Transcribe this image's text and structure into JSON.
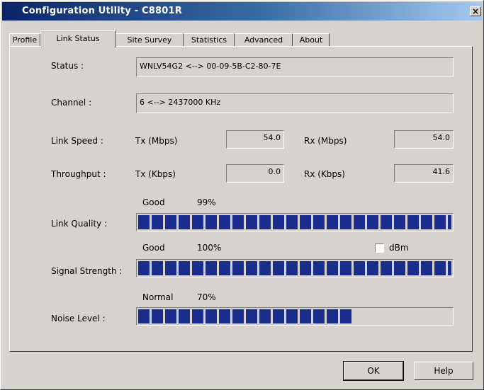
{
  "window": {
    "title": "Configuration Utility - C8801R",
    "close": "×"
  },
  "tabs": [
    "Profile",
    "Link Status",
    "Site Survey",
    "Statistics",
    "Advanced",
    "About"
  ],
  "active_tab": "Link Status",
  "status": {
    "label": "Status :",
    "value": "WNLV54G2 <--> 00-09-5B-C2-80-7E"
  },
  "channel": {
    "label": "Channel :",
    "value": "6 <--> 2437000 KHz"
  },
  "link_speed": {
    "label": "Link Speed :",
    "tx_label": "Tx (Mbps)",
    "tx_value": "54.0",
    "rx_label": "Rx (Mbps)",
    "rx_value": "54.0"
  },
  "throughput": {
    "label": "Throughput :",
    "tx_label": "Tx (Kbps)",
    "tx_value": "0.0",
    "rx_label": "Rx (Kbps)",
    "rx_value": "41.6"
  },
  "link_quality": {
    "label": "Link Quality :",
    "rating": "Good",
    "percent": "99%",
    "level": 0.99
  },
  "signal_strength": {
    "label": "Signal Strength :",
    "rating": "Good",
    "percent": "100%",
    "level": 1.0,
    "dbm_label": "dBm",
    "dbm_checked": false
  },
  "noise_level": {
    "label": "Noise Level :",
    "rating": "Normal",
    "percent": "70%",
    "level": 0.7
  },
  "buttons": {
    "ok": "OK",
    "help": "Help"
  },
  "colors": {
    "bar": "#1a2d8c",
    "title_start": "#0a246a",
    "title_end": "#a6caf0"
  }
}
